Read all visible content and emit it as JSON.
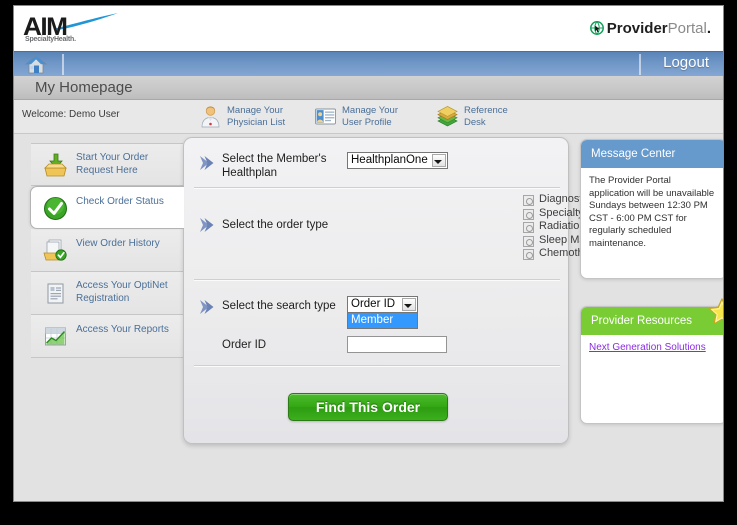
{
  "window": {
    "page_title": "My Homepage"
  },
  "masthead": {
    "logo_text": "AIM",
    "logo_subtext": "SpecialtyHealth.",
    "brand_part1": "Provider",
    "brand_part2": "Portal",
    "brand_part3": "."
  },
  "navbar": {
    "home_icon": "home-icon",
    "logout_label": "Logout"
  },
  "welcome": {
    "text": "Welcome: Demo User",
    "links": [
      {
        "label": "Manage Your Physician List",
        "line1": "Manage Your",
        "line2": "Physician List",
        "icon": "physician-icon"
      },
      {
        "label": "Manage Your User Profile",
        "line1": "Manage Your",
        "line2": "User Profile",
        "icon": "user-profile-icon"
      },
      {
        "label": "Reference Desk",
        "line1": "Reference",
        "line2": "Desk",
        "icon": "reference-desk-icon"
      }
    ]
  },
  "sidebar": {
    "items": [
      {
        "line1": "Start Your Order Request",
        "line2": "Here",
        "icon": "inbox-download-icon",
        "active": false
      },
      {
        "line1": "Check Order Status",
        "line2": "",
        "icon": "green-check-icon",
        "active": true
      },
      {
        "line1": "View Order History",
        "line2": "",
        "icon": "documents-check-icon",
        "active": false
      },
      {
        "line1": "Access Your OptiNet",
        "line2": "Registration",
        "icon": "form-document-icon",
        "active": false
      },
      {
        "line1": "Access Your Reports",
        "line2": "",
        "icon": "chart-report-icon",
        "active": false
      }
    ]
  },
  "form": {
    "healthplan": {
      "label_line1": "Select the Member's",
      "label_line2": "Healthplan",
      "selected": "HealthplanOne"
    },
    "order_type": {
      "label": "Select the order type",
      "options": [
        "Diagnostic Imaging",
        "Specialty Drug",
        "Radiation Therapy",
        "Sleep Management",
        "Chemotherapy and Supportive Drugs"
      ]
    },
    "search_type": {
      "label": "Select the search type",
      "selected": "Order ID",
      "open": true,
      "options": [
        "Member"
      ],
      "highlighted": "Member"
    },
    "order_id": {
      "label": "Order ID",
      "value": "",
      "placeholder": ""
    },
    "submit_label": "Find This Order"
  },
  "message_center": {
    "title": "Message Center",
    "body": "The Provider Portal application will be unavailable Sundays between 12:30 PM CST - 6:00 PM CST for regularly scheduled maintenance."
  },
  "provider_resources": {
    "title": "Provider Resources",
    "link": "Next Generation Solutions",
    "badge_icon": "star-icon"
  },
  "colors": {
    "nav_blue": "#6f96c6",
    "message_header": "#6699cc",
    "resources_header": "#79cc33",
    "submit_green": "#34a814",
    "link_blue": "#4a6f98",
    "link_purple": "#8a2be2",
    "dropdown_highlight": "#3399ff",
    "star_yellow": "#f5e03c"
  }
}
